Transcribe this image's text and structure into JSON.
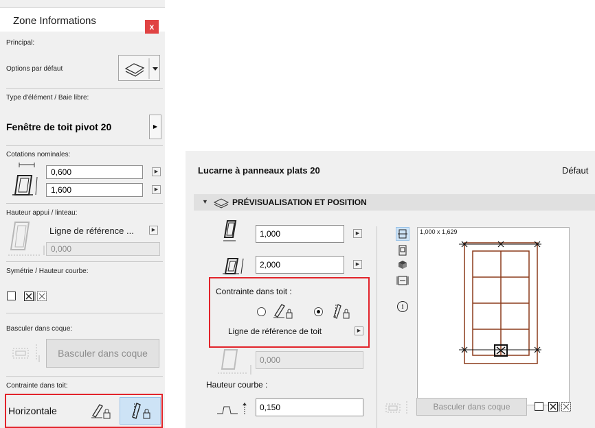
{
  "left_panel": {
    "title": "Zone Informations",
    "close_glyph": "x",
    "principal_label": "Principal:",
    "default_options_label": "Options par défaut",
    "element_type_label": "Type d'élément / Baie libre:",
    "element_name": "Fenêtre de toit pivot 20",
    "nominal_dims_label": "Cotations nominales:",
    "width_value": "0,600",
    "height_value": "1,600",
    "sill_header_label": "Hauteur appui / linteau:",
    "sill_ref_value": "Ligne de référence ...",
    "sill_value": "0,000",
    "symmetry_label": "Symétrie / Hauteur courbe:",
    "shell_label": "Basculer dans coque:",
    "shell_button": "Basculer dans coque",
    "constraint_label": "Contrainte dans toit:",
    "constraint_value": "Horizontale"
  },
  "right_panel": {
    "title": "Lucarne à panneaux plats 20",
    "default_label": "Défaut",
    "section_label": "PRÉVISUALISATION ET POSITION",
    "width_value": "1,000",
    "height_value": "2,000",
    "constraint_label": "Contrainte dans toit :",
    "ref_label": "Ligne de référence de toit",
    "sill_value": "0,000",
    "curve_label": "Hauteur courbe :",
    "curve_value": "0,150",
    "preview_dims": "1,000 x 1,629",
    "shell_button": "Basculer dans coque",
    "info_glyph": "i"
  },
  "colors": {
    "highlight_border": "#e2232a",
    "close_bg": "#e04343",
    "selected_btn": "#cde3f6",
    "window_frame": "#8b3a1a"
  },
  "icons": [
    "layers-icon",
    "chevron-down-icon",
    "window-size-icon",
    "window-height-icon",
    "lock-pen-icon",
    "cube-icon",
    "info-icon",
    "shell-icon"
  ]
}
